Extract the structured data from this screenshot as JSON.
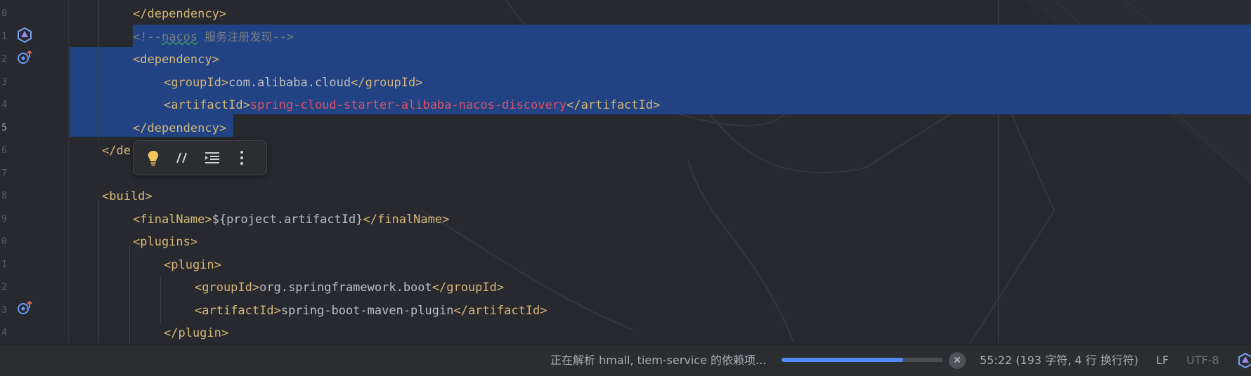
{
  "editor": {
    "lines": [
      {
        "no": "0",
        "parts": [
          {
            "c": "tag",
            "t": "</dependency>"
          }
        ]
      },
      {
        "no": "1",
        "parts": [
          {
            "c": "cmt",
            "t": "<!--"
          },
          {
            "c": "cmt typo",
            "t": "nacos"
          },
          {
            "c": "cmt",
            "t": " "
          },
          {
            "c": "cmt-cn",
            "t": "服务注册发现"
          },
          {
            "c": "cmt",
            "t": "-->"
          }
        ]
      },
      {
        "no": "2",
        "parts": [
          {
            "c": "tag",
            "t": "<dependency>"
          }
        ]
      },
      {
        "no": "3",
        "parts": [
          {
            "c": "tag",
            "t": "<groupId>"
          },
          {
            "c": "txt",
            "t": "com.alibaba.cloud"
          },
          {
            "c": "tag",
            "t": "</groupId>"
          }
        ]
      },
      {
        "no": "4",
        "parts": [
          {
            "c": "tag",
            "t": "<artifactId>"
          },
          {
            "c": "red",
            "t": "spring-cloud-starter-alibaba-nacos-discovery"
          },
          {
            "c": "tag",
            "t": "</artifactId>"
          }
        ]
      },
      {
        "no": "5",
        "parts": [
          {
            "c": "tag",
            "t": "</dependency>"
          }
        ]
      },
      {
        "no": "6",
        "parts": [
          {
            "c": "tag",
            "t": "</de"
          }
        ]
      },
      {
        "no": "7",
        "parts": []
      },
      {
        "no": "8",
        "parts": [
          {
            "c": "tag",
            "t": "<build>"
          }
        ]
      },
      {
        "no": "9",
        "parts": [
          {
            "c": "tag",
            "t": "<finalName>"
          },
          {
            "c": "txt",
            "t": "${project.artifactId}"
          },
          {
            "c": "tag",
            "t": "</finalName>"
          }
        ]
      },
      {
        "no": "0",
        "parts": [
          {
            "c": "tag",
            "t": "<plugins>"
          }
        ]
      },
      {
        "no": "1",
        "parts": [
          {
            "c": "tag",
            "t": "<plugin>"
          }
        ]
      },
      {
        "no": "2",
        "parts": [
          {
            "c": "tag",
            "t": "<groupId>"
          },
          {
            "c": "txt",
            "t": "org.springframework.boot"
          },
          {
            "c": "tag",
            "t": "</groupId>"
          }
        ]
      },
      {
        "no": "3",
        "parts": [
          {
            "c": "tag",
            "t": "<artifactId>"
          },
          {
            "c": "txt",
            "t": "spring-boot-maven-plugin"
          },
          {
            "c": "tag",
            "t": "</artifactId>"
          }
        ]
      },
      {
        "no": "4",
        "parts": [
          {
            "c": "tag",
            "t": "</plugin>"
          }
        ]
      }
    ],
    "gutter_icons": [
      "spring-icon",
      "maven-override-icon",
      "maven-override-icon"
    ]
  },
  "floating_toolbar": {
    "items": [
      "intention-bulb-icon",
      "comment-toggle-icon",
      "reformat-icon",
      "more-icon"
    ]
  },
  "status": {
    "progress_text": "正在解析 hmall, tiem-service 的依赖项...",
    "progress_fraction": 0.75,
    "cursor_info": "55:22 (193 字符, 4 行 换行符)",
    "line_separator": "LF",
    "encoding": "UTF-8",
    "accent": "#548af7"
  }
}
